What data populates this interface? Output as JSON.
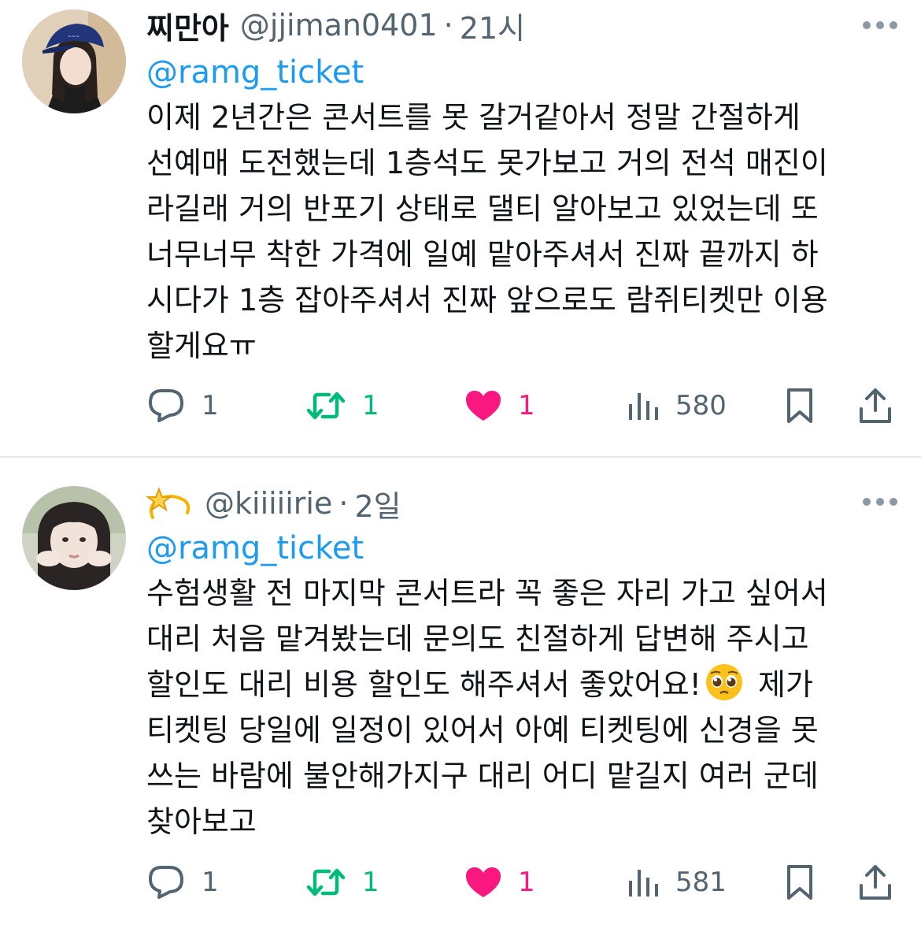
{
  "tweets": [
    {
      "name": "찌만아",
      "handle": "@jjiman0401",
      "separator": "·",
      "time": "21시",
      "mention": "@ramg_ticket",
      "lines": [
        "이제 2년간은 콘서트를 못 갈거같아서 정말 간절하게",
        "선예매 도전했는데 1층석도 못가보고 거의 전석 매진이",
        "라길래 거의 반포기 상태로 댈티 알아보고 있었는데 또",
        "너무너무 착한 가격에 일예 맡아주셔서 진짜 끝까지 하",
        "시다가 1층 잡아주셔서 진짜 앞으로도 람쥐티켓만 이용",
        "할게요ㅠ"
      ],
      "replies": "1",
      "retweets": "1",
      "likes": "1",
      "views": "580"
    },
    {
      "name_emoji": "dizzy-star-emoji",
      "handle": "@kiiiiirie",
      "separator": "·",
      "time": "2일",
      "mention": "@ramg_ticket",
      "lines": [
        "수험생활 전 마지막 콘서트라 꼭 좋은 자리 가고 싶어서",
        "대리 처음 맡겨봤는데 문의도 친절하게 답변해 주시고",
        "할인도 대리 비용 할인도 해주셔서 좋았어요!",
        "티켓팅 당일에 일정이 있어서 아예 티켓팅에 신경을 못",
        "쓰는 바람에 불안해가지구 대리 어디 맡길지 여러 군데",
        "찾아보고"
      ],
      "line3_suffix": " 제가",
      "replies": "1",
      "retweets": "1",
      "likes": "1",
      "views": "581"
    }
  ],
  "colors": {
    "text": "#0f1419",
    "secondary": "#536471",
    "link": "#1d9bf0",
    "retweet": "#00ba7c",
    "like": "#f91880",
    "divider": "#e7e9ea"
  },
  "icons": [
    "reply-icon",
    "retweet-icon",
    "like-heart-icon",
    "views-chart-icon",
    "bookmark-icon",
    "share-icon",
    "more-icon"
  ]
}
